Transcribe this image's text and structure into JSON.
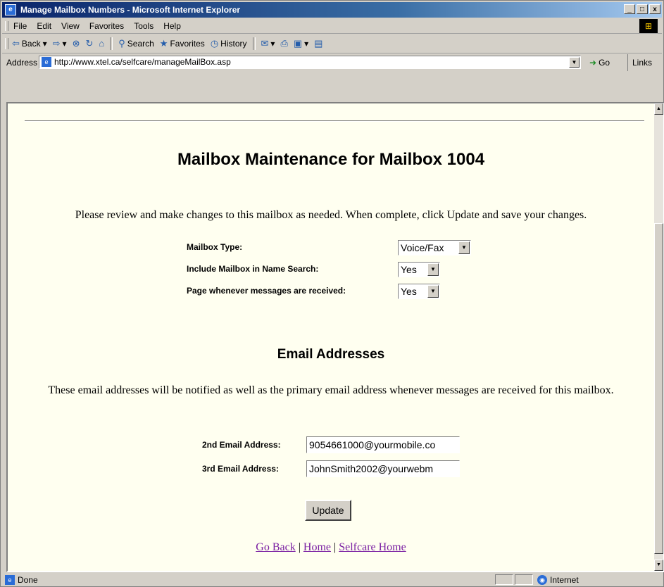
{
  "window": {
    "title": "Manage Mailbox Numbers - Microsoft Internet Explorer",
    "controls": [
      "_",
      "□",
      "x"
    ]
  },
  "menu": [
    "File",
    "Edit",
    "View",
    "Favorites",
    "Tools",
    "Help"
  ],
  "toolbar": {
    "back": "Back",
    "search": "Search",
    "favorites": "Favorites",
    "history": "History"
  },
  "address": {
    "label": "Address",
    "url": "http://www.xtel.ca/selfcare/manageMailBox.asp",
    "go": "Go",
    "links": "Links"
  },
  "page": {
    "heading": "Mailbox Maintenance for Mailbox 1004",
    "intro": "Please review and make changes to this mailbox as needed. When complete, click Update and save your changes.",
    "fields": [
      {
        "label": "Mailbox Type:",
        "value": "Voice/Fax"
      },
      {
        "label": "Include Mailbox in Name Search:",
        "value": "Yes"
      },
      {
        "label": "Page whenever messages are received:",
        "value": "Yes"
      }
    ],
    "email_heading": "Email Addresses",
    "email_note": "These email addresses will be notified as well as the primary email address whenever messages are received for this mailbox.",
    "emails": [
      {
        "label": "2nd Email Address:",
        "value": "9054661000@yourmobile.co"
      },
      {
        "label": "3rd Email Address:",
        "value": "JohnSmith2002@yourwebm"
      }
    ],
    "update_label": "Update",
    "links": [
      "Go Back",
      "Home",
      "Selfcare Home"
    ],
    "link_separator": "|"
  },
  "status": {
    "left": "Done",
    "zone": "Internet"
  },
  "colors": {
    "page_background": "#fffff0",
    "link": "#7a1fa2",
    "titlebar_start": "#0a246a"
  }
}
